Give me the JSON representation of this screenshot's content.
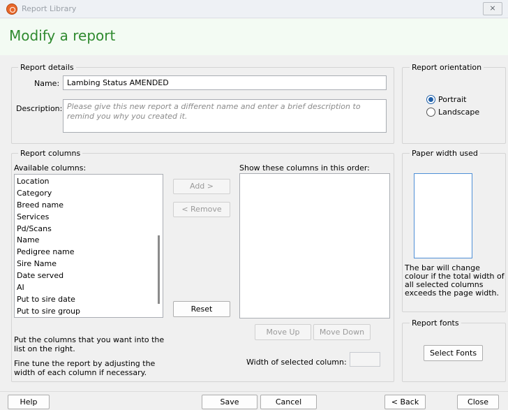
{
  "window": {
    "title": "Report Library",
    "close_glyph": "⨯"
  },
  "page": {
    "title": "Modify a report"
  },
  "report_details": {
    "group_title": "Report details",
    "name_label": "Name:",
    "name_value": "Lambing Status AMENDED",
    "description_label": "Description:",
    "description_placeholder": "Please give this new report a different name and enter a brief description to remind you why you created it."
  },
  "orientation": {
    "group_title": "Report orientation",
    "options": [
      {
        "label": "Portrait",
        "checked": true
      },
      {
        "label": "Landscape",
        "checked": false
      }
    ]
  },
  "columns": {
    "group_title": "Report columns",
    "available_label": "Available columns:",
    "available": [
      "Location",
      "Category",
      "Breed name",
      "Services",
      "Pd/Scans",
      "Name",
      "Pedigree name",
      "Sire Name",
      "Date served",
      "AI",
      "Put to sire date",
      "Put to sire group"
    ],
    "selected_label": "Show these columns in this order:",
    "add_label": "Add >",
    "remove_label": "< Remove",
    "reset_label": "Reset",
    "move_up_label": "Move Up",
    "move_down_label": "Move Down",
    "hint1": "Put the columns that you want into the list on the right.",
    "hint2": "Fine tune the report by adjusting the width of each column if necessary.",
    "width_label": "Width of selected column:",
    "width_value": ""
  },
  "paper": {
    "group_title": "Paper width used",
    "note": "The bar will change colour if the total width of all selected columns exceeds the page width."
  },
  "fonts": {
    "group_title": "Report fonts",
    "button_label": "Select Fonts"
  },
  "footer": {
    "help_label": "Help",
    "save_label": "Save",
    "cancel_label": "Cancel",
    "back_label": "< Back",
    "close_label": "Close"
  }
}
